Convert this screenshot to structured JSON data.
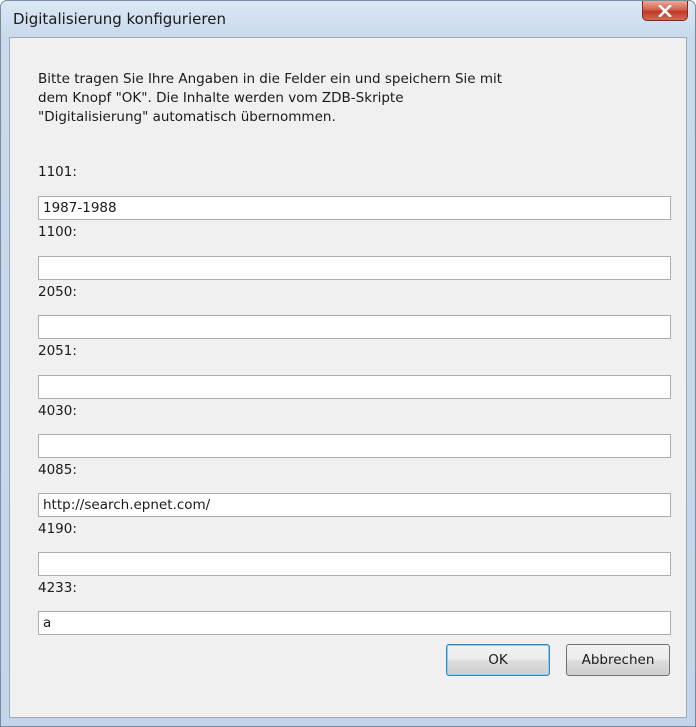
{
  "window": {
    "title": "Digitalisierung konfigurieren"
  },
  "intro_text": "Bitte tragen Sie Ihre Angaben in die Felder ein und speichern Sie mit\ndem Knopf \"OK\". Die Inhalte werden vom ZDB-Skripte\n\"Digitalisierung\" automatisch übernommen.",
  "fields": [
    {
      "label": "1101:",
      "value": "1987-1988"
    },
    {
      "label": "1100:",
      "value": ""
    },
    {
      "label": "2050:",
      "value": ""
    },
    {
      "label": "2051:",
      "value": ""
    },
    {
      "label": "4030:",
      "value": ""
    },
    {
      "label": "4085:",
      "value": "http://search.epnet.com/"
    },
    {
      "label": "4190:",
      "value": ""
    },
    {
      "label": "4233:",
      "value": "a"
    }
  ],
  "buttons": {
    "ok_label": "OK",
    "cancel_label": "Abbrechen"
  },
  "icons": {
    "close": "close-icon"
  },
  "colors": {
    "close_button": "#c0392b",
    "ok_button_border": "#3c7fb1"
  }
}
